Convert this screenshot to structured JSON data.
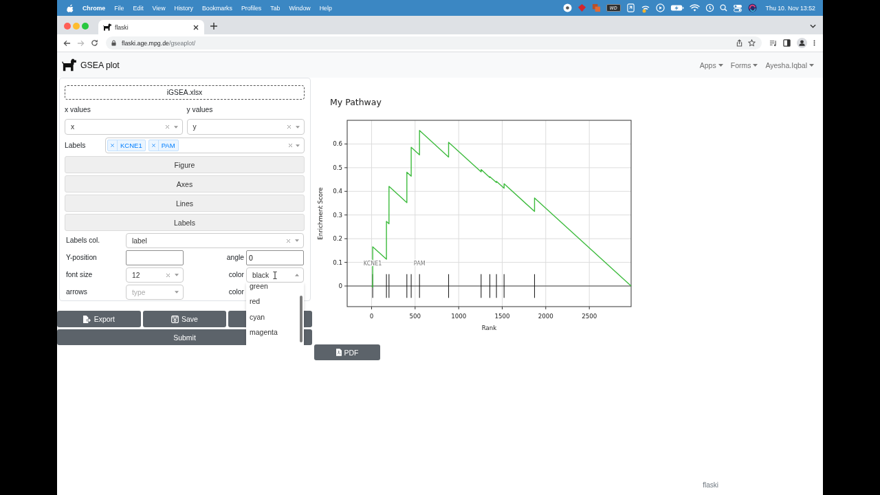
{
  "menu_bar": {
    "app": "Chrome",
    "items": [
      "File",
      "Edit",
      "View",
      "History",
      "Bookmarks",
      "Profiles",
      "Tab",
      "Window",
      "Help"
    ],
    "status_badge": "WD",
    "clock": "Thu 10. Nov 13:52"
  },
  "browser": {
    "tabs": [
      {
        "title": "flaski",
        "selected": true
      }
    ],
    "url_host": "flaski.age.mpg.de",
    "url_path": "/gseaplot/"
  },
  "navbar": {
    "brand": "GSEA plot",
    "menus": [
      "Apps",
      "Forms",
      "Ayesha.Iqbal"
    ]
  },
  "form": {
    "file": "iGSEA.xlsx",
    "x_values": {
      "label": "x values",
      "value": "x"
    },
    "y_values": {
      "label": "y values",
      "value": "y"
    },
    "labels": {
      "label": "Labels",
      "chips": [
        "KCNE1",
        "PAM"
      ]
    },
    "sections": [
      {
        "title": "Figure"
      },
      {
        "title": "Axes"
      },
      {
        "title": "Lines"
      },
      {
        "title": "Labels",
        "rows": [
          [
            {
              "label": "Labels col.",
              "kind": "select",
              "value": "label",
              "open": false
            }
          ],
          [
            {
              "label": "Y-position",
              "kind": "input"
            },
            {
              "label": "angle",
              "kind": "input",
              "value": "0"
            }
          ],
          [
            {
              "label": "font size",
              "kind": "select",
              "value": "12",
              "open": false
            },
            {
              "label": "color",
              "kind": "select",
              "value": "black",
              "open": true
            }
          ],
          [
            {
              "label": "arrows",
              "kind": "select",
              "placeholder": "type",
              "open": false
            },
            {
              "label": "color"
            }
          ]
        ],
        "dropdown": {
          "options": [
            {
              "label": "green",
              "selected": false
            },
            {
              "label": "red",
              "selected": false
            },
            {
              "label": "cyan",
              "selected": false
            },
            {
              "label": "magenta",
              "selected": false
            }
          ]
        }
      }
    ],
    "actions": [
      {
        "kind": "export",
        "label": "Export"
      },
      {
        "kind": "save",
        "label": "Save"
      },
      {
        "kind": "plain"
      }
    ],
    "submit": "Submit"
  },
  "chart": {
    "chart_data": {
      "type": "line",
      "title": "My Pathway",
      "xlabel": "Rank",
      "ylabel": "Enrichment Score",
      "x": [
        0,
        13,
        13,
        171,
        171,
        200,
        200,
        405,
        405,
        455,
        455,
        550,
        550,
        884,
        884,
        1258,
        1258,
        1358,
        1358,
        1434,
        1434,
        1521,
        1521,
        1871,
        1871,
        2980
      ],
      "series": [
        {
          "color": "#3dbb3d",
          "values": [
            0,
            -0.004,
            0.166,
            0.113,
            0.273,
            0.263,
            0.421,
            0.352,
            0.481,
            0.464,
            0.586,
            0.554,
            0.657,
            0.545,
            0.607,
            0.482,
            0.492,
            0.458,
            0.462,
            0.437,
            0.442,
            0.413,
            0.432,
            0.315,
            0.372,
            0
          ]
        }
      ],
      "xlim": [
        -280,
        2980
      ],
      "ylim": [
        -0.087,
        0.7
      ],
      "xticks": [
        0,
        500,
        1000,
        1500,
        2000,
        2500
      ],
      "yticks": [
        0,
        0.1,
        0.2,
        0.3,
        0.4,
        0.5,
        0.6
      ],
      "grid": true,
      "ref_lines": [
        {
          "axis": "x",
          "value": 13,
          "label": "KCNE1"
        },
        {
          "axis": "x",
          "value": 171
        },
        {
          "axis": "x",
          "value": 200
        },
        {
          "axis": "x",
          "value": 405
        },
        {
          "axis": "x",
          "value": 455
        },
        {
          "axis": "x",
          "value": 550,
          "label": "PAM"
        },
        {
          "axis": "x",
          "value": 884
        },
        {
          "axis": "x",
          "value": 1258
        },
        {
          "axis": "x",
          "value": 1358
        },
        {
          "axis": "x",
          "value": 1434
        },
        {
          "axis": "x",
          "value": 1521
        },
        {
          "axis": "x",
          "value": 1871
        }
      ]
    },
    "download": "PDF"
  },
  "footer": "flaski"
}
